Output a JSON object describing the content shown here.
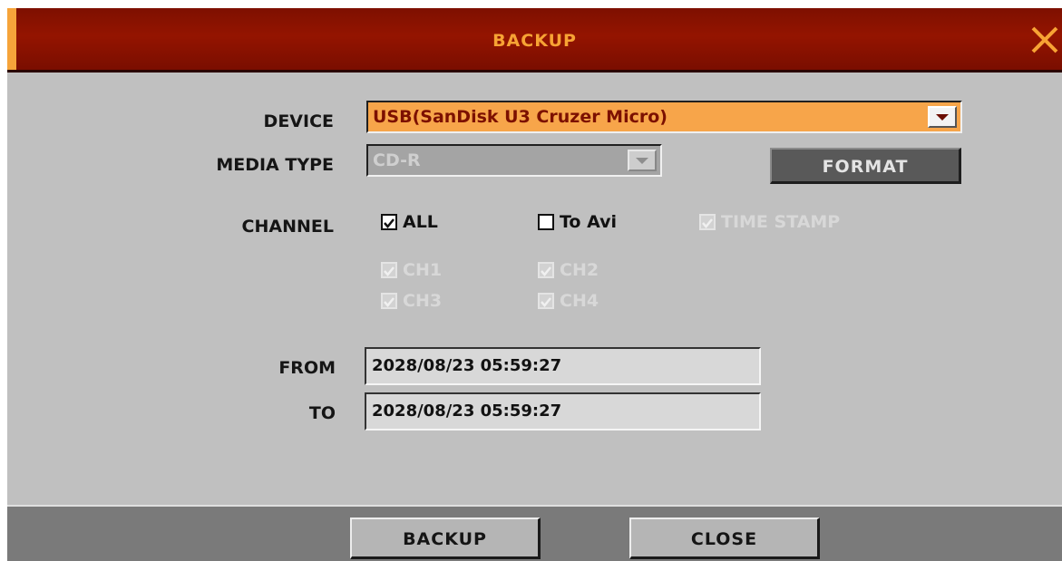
{
  "title": "BACKUP",
  "icons": {
    "close": "close-x-icon",
    "dropdown": "chevron-down-icon",
    "check": "checkmark-icon"
  },
  "colors": {
    "title_bar": "#8a1200",
    "accent": "#f7a334",
    "body": "#c0c0c0",
    "footer": "#7a7a7a"
  },
  "device": {
    "label": "DEVICE",
    "value": "USB(SanDisk U3 Cruzer Micro)"
  },
  "media_type": {
    "label": "MEDIA TYPE",
    "value": "CD-R",
    "enabled": false
  },
  "format_button": "FORMAT",
  "channel": {
    "label": "CHANNEL",
    "all": {
      "label": "ALL",
      "checked": true,
      "enabled": true
    },
    "to_avi": {
      "label": "To Avi",
      "checked": false,
      "enabled": true
    },
    "time_stamp": {
      "label": "TIME STAMP",
      "checked": true,
      "enabled": false
    },
    "channels": [
      {
        "label": "CH1",
        "checked": true,
        "enabled": false
      },
      {
        "label": "CH2",
        "checked": true,
        "enabled": false
      },
      {
        "label": "CH3",
        "checked": true,
        "enabled": false
      },
      {
        "label": "CH4",
        "checked": true,
        "enabled": false
      }
    ]
  },
  "from": {
    "label": "FROM",
    "value": "2028/08/23 05:59:27"
  },
  "to": {
    "label": "TO",
    "value": "2028/08/23 05:59:27"
  },
  "footer": {
    "backup_button": "BACKUP",
    "close_button": "CLOSE"
  }
}
